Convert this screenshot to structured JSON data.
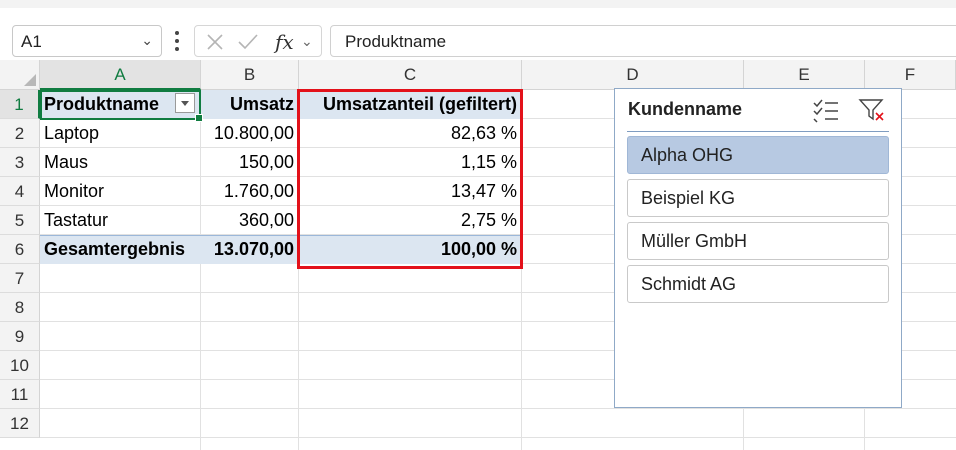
{
  "formula_bar": {
    "name_box": "A1",
    "formula": "Produktname",
    "fx_label": "fx"
  },
  "columns": [
    "A",
    "B",
    "C",
    "D",
    "E",
    "F"
  ],
  "rows": [
    "1",
    "2",
    "3",
    "4",
    "5",
    "6",
    "7",
    "8",
    "9",
    "10",
    "11",
    "12"
  ],
  "table": {
    "headers": {
      "a": "Produktname",
      "b": "Umsatz",
      "c": "Umsatzanteil (gefiltert)"
    },
    "body": [
      {
        "a": "Laptop",
        "b": "10.800,00",
        "c": "82,63 %"
      },
      {
        "a": "Maus",
        "b": "150,00",
        "c": "1,15 %"
      },
      {
        "a": "Monitor",
        "b": "1.760,00",
        "c": "13,47 %"
      },
      {
        "a": "Tastatur",
        "b": "360,00",
        "c": "2,75 %"
      }
    ],
    "total": {
      "a": "Gesamtergebnis",
      "b": "13.070,00",
      "c": "100,00 %"
    }
  },
  "slicer": {
    "title": "Kundenname",
    "items": [
      {
        "label": "Alpha OHG",
        "selected": true
      },
      {
        "label": "Beispiel KG",
        "selected": false
      },
      {
        "label": "Müller GmbH",
        "selected": false
      },
      {
        "label": "Schmidt AG",
        "selected": false
      }
    ]
  },
  "colors": {
    "accent_green": "#107c41",
    "highlight_red": "#e3111a",
    "pivot_fill": "#dce6f1",
    "slicer_selected": "#b7c9e2"
  }
}
